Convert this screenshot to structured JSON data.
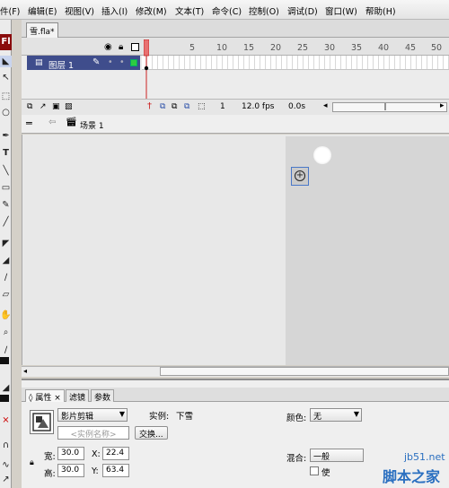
{
  "menu": [
    "件(F)",
    "编辑(E)",
    "视图(V)",
    "插入(I)",
    "修改(M)",
    "文本(T)",
    "命令(C)",
    "控制(O)",
    "调试(D)",
    "窗口(W)",
    "帮助(H)"
  ],
  "tools": {
    "logo": "Fl"
  },
  "document": {
    "tab_title": "雪.fla*"
  },
  "timeline": {
    "frame_numbers": [
      "5",
      "10",
      "15",
      "20",
      "25",
      "30",
      "35",
      "40",
      "45",
      "50"
    ],
    "layer_name": "图层 1",
    "current_frame": "1",
    "frame_rate": "12.0 fps",
    "elapsed_time": "0.0s"
  },
  "editbar": {
    "scene_name": "场景 1"
  },
  "properties": {
    "tabs": [
      "属性",
      "滤镜",
      "参数"
    ],
    "symbol_type": "影片剪辑",
    "instance_label": "实例:",
    "instance_name": "下雪",
    "instance_name_placeholder": "<实例名称>",
    "swap_button": "交换...",
    "width_label": "宽:",
    "width_value": "30.0",
    "height_label": "高:",
    "height_value": "30.0",
    "x_label": "X:",
    "x_value": "22.4",
    "y_label": "Y:",
    "y_value": "63.4",
    "color_label": "颜色:",
    "color_value": "无",
    "blend_label": "混合:",
    "blend_value": "一般",
    "cache_label": "使"
  },
  "watermark": {
    "site": "jb51.net",
    "name": "脚本之家"
  },
  "colors": {
    "layer_selected": "#3f4d8c",
    "stage": "#d6d6d6",
    "pasteboard": "#e8e8e8",
    "logo": "#8a0c0c",
    "playhead": "#cc2222"
  }
}
